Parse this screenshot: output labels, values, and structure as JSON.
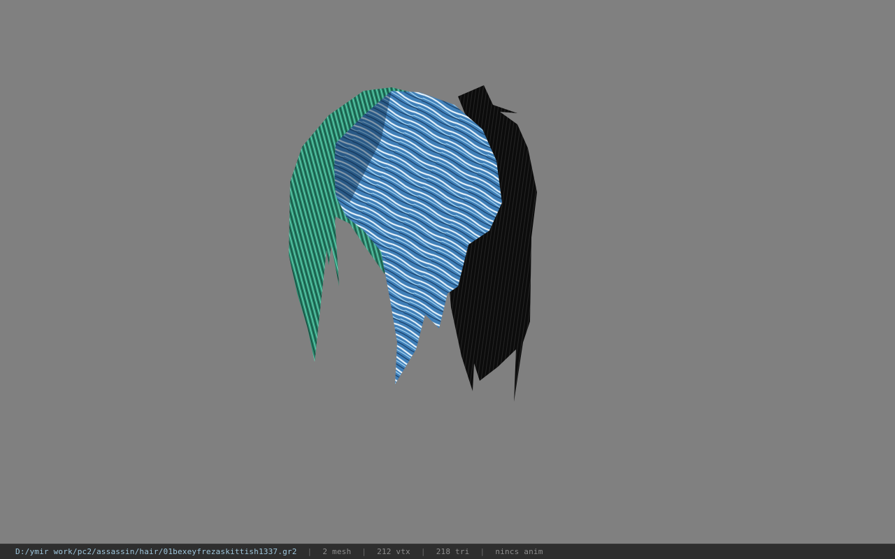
{
  "viewport": {
    "background_color": "#808080",
    "model": {
      "name": "hair-mesh",
      "colors": {
        "blue_strands": "#5aa0d8",
        "blue_highlight": "#e6f2fa",
        "teal_strands": "#2f9a7c",
        "black_strands": "#0d0d0d"
      }
    }
  },
  "statusbar": {
    "file_path": "D:/ymir work/pc2/assassin/hair/01bexeyfrezaskittish1337.gr2",
    "separator": "|",
    "mesh_count": "2 mesh",
    "vertex_count": "212 vtx",
    "triangle_count": "218 tri",
    "anim_status": "nincs anim"
  }
}
